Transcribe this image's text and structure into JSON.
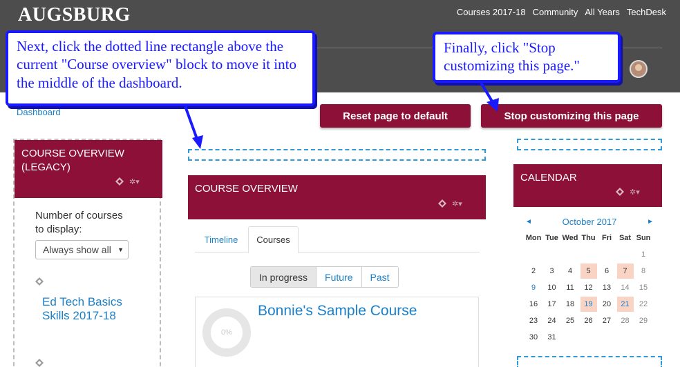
{
  "header": {
    "logo": "AUGSBURG",
    "nav": [
      "Courses 2017-18",
      "Community",
      "All Years",
      "TechDesk"
    ]
  },
  "callouts": {
    "left": "Next, click the dotted line rectangle above the current \"Course overview\" block to move it into the middle of the dashboard.",
    "right": "Finally, click \"Stop customizing this page.\""
  },
  "breadcrumb": "Dashboard",
  "buttons": {
    "reset": "Reset page to default",
    "stop": "Stop customizing this page"
  },
  "left_block": {
    "title_line1": "COURSE OVERVIEW",
    "title_line2": "(LEGACY)",
    "courses_label_line1": "Number of courses",
    "courses_label_line2": "to display:",
    "select_value": "Always show all",
    "course_line1": "Ed Tech Basics",
    "course_line2": "Skills 2017-18"
  },
  "middle_block": {
    "title": "COURSE OVERVIEW",
    "tabs": [
      "Timeline",
      "Courses"
    ],
    "filters": [
      "In progress",
      "Future",
      "Past"
    ],
    "course_title": "Bonnie's Sample Course",
    "progress": "0%"
  },
  "calendar": {
    "title": "CALENDAR",
    "month": "October 2017",
    "prev": "◄",
    "next": "►",
    "days": [
      "Mon",
      "Tue",
      "Wed",
      "Thu",
      "Fri",
      "Sat",
      "Sun"
    ],
    "weeks": [
      [
        "",
        "",
        "",
        "",
        "",
        "",
        "1"
      ],
      [
        "2",
        "3",
        "4",
        "5",
        "6",
        "7",
        "8"
      ],
      [
        "9",
        "10",
        "11",
        "12",
        "13",
        "14",
        "15"
      ],
      [
        "16",
        "17",
        "18",
        "19",
        "20",
        "21",
        "22"
      ],
      [
        "23",
        "24",
        "25",
        "26",
        "27",
        "28",
        "29"
      ],
      [
        "30",
        "31",
        "",
        "",
        "",
        "",
        ""
      ]
    ],
    "event_days": [
      "5",
      "7",
      "19",
      "21"
    ]
  },
  "colors": {
    "maroon": "#8c1038",
    "header_gray": "#4d4d4d",
    "link_blue": "#1a80c9",
    "callout_blue": "#1a1aff"
  }
}
